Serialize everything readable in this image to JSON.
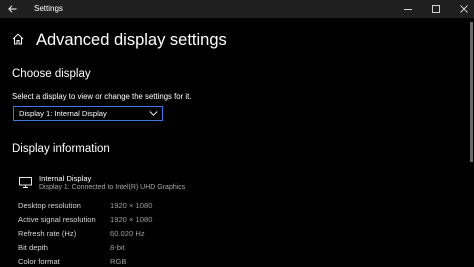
{
  "window": {
    "title": "Settings"
  },
  "header": {
    "page_title": "Advanced display settings"
  },
  "choose_display": {
    "heading": "Choose display",
    "instruction": "Select a display to view or change the settings for it.",
    "selected": "Display 1: Internal Display"
  },
  "display_information": {
    "heading": "Display information",
    "display_name": "Internal Display",
    "display_connection": "Display 1: Connected to Intel(R) UHD Graphics",
    "rows": [
      {
        "label": "Desktop resolution",
        "value": "1920 × 1080"
      },
      {
        "label": "Active signal resolution",
        "value": "1920 × 1080"
      },
      {
        "label": "Refresh rate (Hz)",
        "value": "60.020 Hz"
      },
      {
        "label": "Bit depth",
        "value": "8-bit"
      },
      {
        "label": "Color format",
        "value": "RGB"
      }
    ]
  },
  "icons": {
    "back": "back-arrow-icon",
    "minimize": "minimize-icon",
    "maximize": "maximize-icon",
    "close": "close-icon",
    "home": "home-icon",
    "chevron": "chevron-down-icon",
    "monitor": "monitor-icon"
  },
  "colors": {
    "background": "#000000",
    "titlebar": "#1f1f1f",
    "accent": "#3b78e7",
    "secondary_text": "#a6a6a6"
  }
}
